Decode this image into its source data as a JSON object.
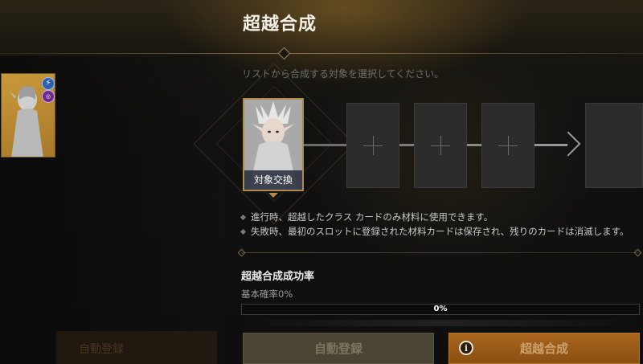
{
  "header": {
    "title": "超越合成"
  },
  "instruction": "リストから合成する対象を選択してください。",
  "left_list": {
    "card_badges": {
      "top": "bolt-icon",
      "bottom": "class-icon"
    }
  },
  "faint_left_button": "自動登録",
  "slots": {
    "selected_label": "対象交換",
    "empty_count": 3
  },
  "notes": [
    "進行時、超越したクラス カードのみ材料に使用できます。",
    "失敗時、最初のスロットに登録された材料カードは保存され、残りのカードは消滅します。"
  ],
  "success_rate": {
    "title": "超越合成成功率",
    "base_rate": "基本確率0%",
    "progress_text": "0%",
    "progress_value": 0
  },
  "buttons": {
    "auto_register": "自動登録",
    "transcend": "超越合成"
  },
  "colors": {
    "accent_gold": "#b08a4a",
    "transcend_orange": "#a9661e"
  }
}
